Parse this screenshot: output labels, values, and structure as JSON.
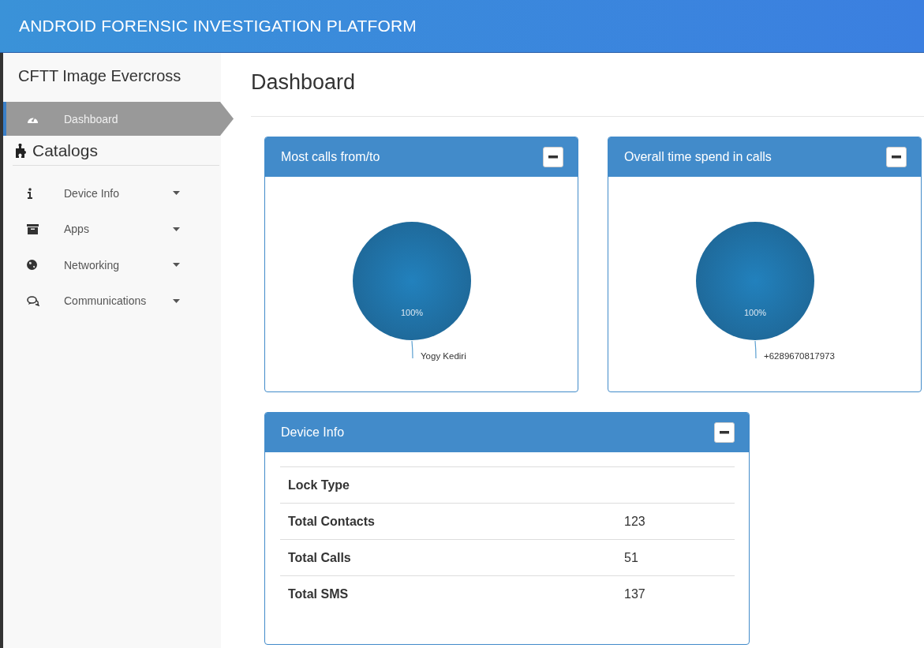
{
  "header": {
    "title": "ANDROID FORENSIC INVESTIGATION PLATFORM"
  },
  "sidebar": {
    "title": "CFTT Image Evercross",
    "top_items": [
      {
        "label": "Dashboard",
        "selected": true
      }
    ],
    "section": {
      "label": "Catalogs"
    },
    "items": [
      {
        "label": "Device Info",
        "selected": false
      },
      {
        "label": "Apps",
        "selected": false
      },
      {
        "label": "Networking",
        "selected": false
      },
      {
        "label": "Communications",
        "selected": false
      }
    ]
  },
  "page": {
    "title": "Dashboard"
  },
  "panels": [
    {
      "kind": "chart",
      "title": "Most calls from/to",
      "chart_data": {
        "type": "pie",
        "categories": [
          "Yogy Kediri"
        ],
        "values": [
          100
        ],
        "value_labels": [
          "100%"
        ]
      }
    },
    {
      "kind": "chart",
      "title": "Overall time spend in calls",
      "chart_data": {
        "type": "pie",
        "categories": [
          "+6289670817973"
        ],
        "values": [
          100
        ],
        "value_labels": [
          "100%"
        ]
      }
    },
    {
      "kind": "table",
      "title": "Device Info",
      "rows": [
        {
          "label": "Lock Type"
        },
        {
          "label": "Total Contacts",
          "value": "123"
        },
        {
          "label": "Total Calls",
          "value": "51"
        },
        {
          "label": "Total SMS",
          "value": "137"
        }
      ]
    }
  ]
}
